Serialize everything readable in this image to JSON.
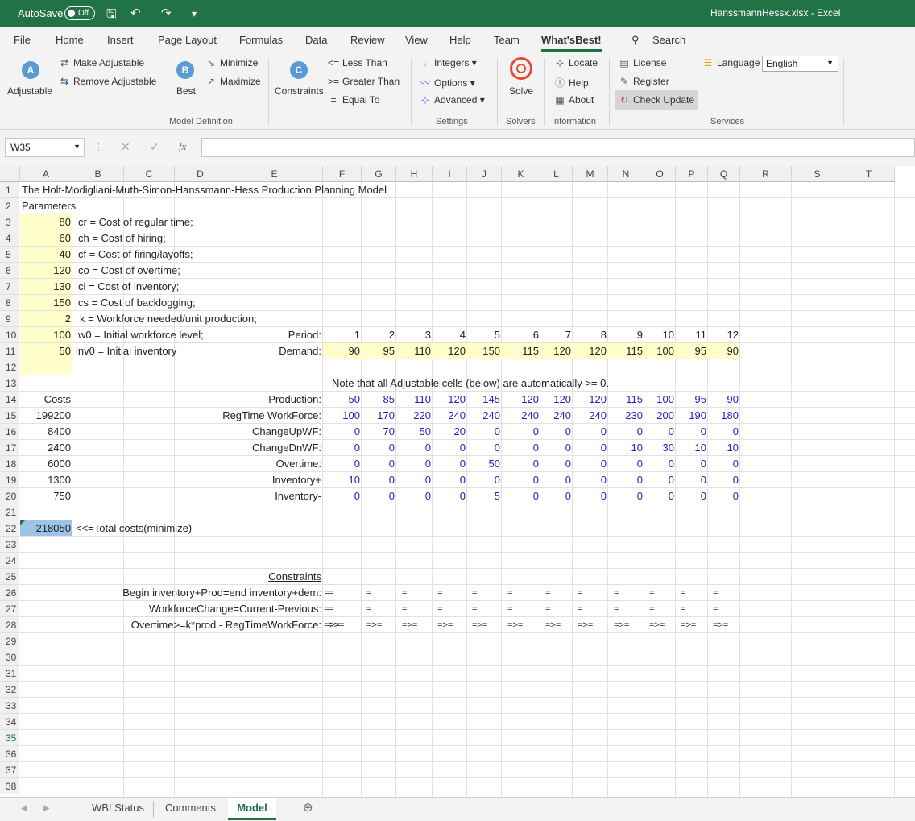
{
  "window": {
    "autosave_label": "AutoSave",
    "autosave_state": "Off",
    "title": "HanssmannHessx.xlsx - Excel"
  },
  "tabs": [
    "File",
    "Home",
    "Insert",
    "Page Layout",
    "Formulas",
    "Data",
    "Review",
    "View",
    "Help",
    "Team",
    "What'sBest!"
  ],
  "search_label": "Search",
  "ribbon": {
    "adjustable": "Adjustable",
    "make_adjustable": "Make Adjustable",
    "remove_adjustable": "Remove Adjustable",
    "best": "Best",
    "minimize": "Minimize",
    "maximize": "Maximize",
    "constraints": "Constraints",
    "less_than": "Less Than",
    "greater_than": "Greater Than",
    "equal_to": "Equal To",
    "integers": "Integers",
    "options": "Options",
    "advanced": "Advanced",
    "solve": "Solve",
    "locate": "Locate",
    "help": "Help",
    "about": "About",
    "license": "License",
    "register": "Register",
    "check_update": "Check Update",
    "language": "Language",
    "language_value": "English",
    "groups": {
      "model_definition": "Model Definition",
      "settings": "Settings",
      "solvers": "Solvers",
      "information": "Information",
      "services": "Services"
    },
    "symbols": {
      "lt": "<=",
      "gt": ">=",
      "eq": "="
    }
  },
  "formula_bar": {
    "name_box": "W35",
    "fx": "fx",
    "formula": ""
  },
  "columns": [
    "A",
    "B",
    "C",
    "D",
    "E",
    "F",
    "G",
    "H",
    "I",
    "J",
    "K",
    "L",
    "M",
    "N",
    "O",
    "P",
    "Q",
    "R",
    "S",
    "T"
  ],
  "rows": [
    "1",
    "2",
    "3",
    "4",
    "5",
    "6",
    "7",
    "8",
    "9",
    "10",
    "11",
    "12",
    "13",
    "14",
    "15",
    "16",
    "17",
    "18",
    "19",
    "20",
    "21",
    "22",
    "23",
    "24",
    "25",
    "26",
    "27",
    "28",
    "29",
    "30",
    "31",
    "32",
    "33",
    "34",
    "35",
    "36",
    "37",
    "38"
  ],
  "sheet": {
    "title": "The Holt-Modigliani-Muth-Simon-Hanssmann-Hess Production Planning Model",
    "parameters_label": "Parameters",
    "params": [
      {
        "value": "80",
        "label": "cr = Cost of regular time;"
      },
      {
        "value": "60",
        "label": "ch = Cost of hiring;"
      },
      {
        "value": "40",
        "label": "cf = Cost of firing/layoffs;"
      },
      {
        "value": "120",
        "label": "co = Cost of overtime;"
      },
      {
        "value": "130",
        "label": "ci = Cost of inventory;"
      },
      {
        "value": "150",
        "label": "cs = Cost of backlogging;"
      },
      {
        "value": "2",
        "label": "k = Workforce needed/unit production;"
      },
      {
        "value": "100",
        "label": "w0 = Initial workforce level;"
      },
      {
        "value": "50",
        "label": "inv0 = Initial inventory"
      }
    ],
    "period_label": "Period:",
    "periods": [
      "1",
      "2",
      "3",
      "4",
      "5",
      "6",
      "7",
      "8",
      "9",
      "10",
      "11",
      "12"
    ],
    "demand_label": "Demand:",
    "demand": [
      "90",
      "95",
      "110",
      "120",
      "150",
      "115",
      "120",
      "120",
      "115",
      "100",
      "95",
      "90"
    ],
    "note": "Note that all Adjustable cells (below) are automatically >= 0.",
    "costs_header": "Costs",
    "vars": [
      {
        "cost": "",
        "label": "Production:",
        "values": [
          "50",
          "85",
          "110",
          "120",
          "145",
          "120",
          "120",
          "120",
          "115",
          "100",
          "95",
          "90"
        ]
      },
      {
        "cost": "199200",
        "label": "RegTime WorkForce:",
        "values": [
          "100",
          "170",
          "220",
          "240",
          "240",
          "240",
          "240",
          "240",
          "230",
          "200",
          "190",
          "180"
        ]
      },
      {
        "cost": "8400",
        "label": "ChangeUpWF:",
        "values": [
          "0",
          "70",
          "50",
          "20",
          "0",
          "0",
          "0",
          "0",
          "0",
          "0",
          "0",
          "0"
        ]
      },
      {
        "cost": "2400",
        "label": "ChangeDnWF:",
        "values": [
          "0",
          "0",
          "0",
          "0",
          "0",
          "0",
          "0",
          "0",
          "10",
          "30",
          "10",
          "10"
        ]
      },
      {
        "cost": "6000",
        "label": "Overtime:",
        "values": [
          "0",
          "0",
          "0",
          "0",
          "50",
          "0",
          "0",
          "0",
          "0",
          "0",
          "0",
          "0"
        ]
      },
      {
        "cost": "1300",
        "label": "Inventory+",
        "values": [
          "10",
          "0",
          "0",
          "0",
          "0",
          "0",
          "0",
          "0",
          "0",
          "0",
          "0",
          "0"
        ]
      },
      {
        "cost": "750",
        "label": "Inventory-",
        "values": [
          "0",
          "0",
          "0",
          "0",
          "5",
          "0",
          "0",
          "0",
          "0",
          "0",
          "0",
          "0"
        ]
      }
    ],
    "total": "218050",
    "total_label": "<<=Total costs(minimize)",
    "constraints_header": "Constraints",
    "constraints": [
      {
        "label": "Begin inventory+Prod=end inventory+dem:",
        "sym": "="
      },
      {
        "label": "WorkforceChange=Current-Previous:",
        "sym": "="
      },
      {
        "label": "Overtime>=k*prod - RegTimeWorkForce:",
        "sym": "=>="
      }
    ]
  },
  "sheet_tabs": [
    "WB! Status",
    "Comments",
    "Model"
  ],
  "colors": {
    "accent": "#217346",
    "blue_text": "#1f1fbf",
    "param_fill": "#ffffcc",
    "total_fill": "#9dc3e6"
  }
}
